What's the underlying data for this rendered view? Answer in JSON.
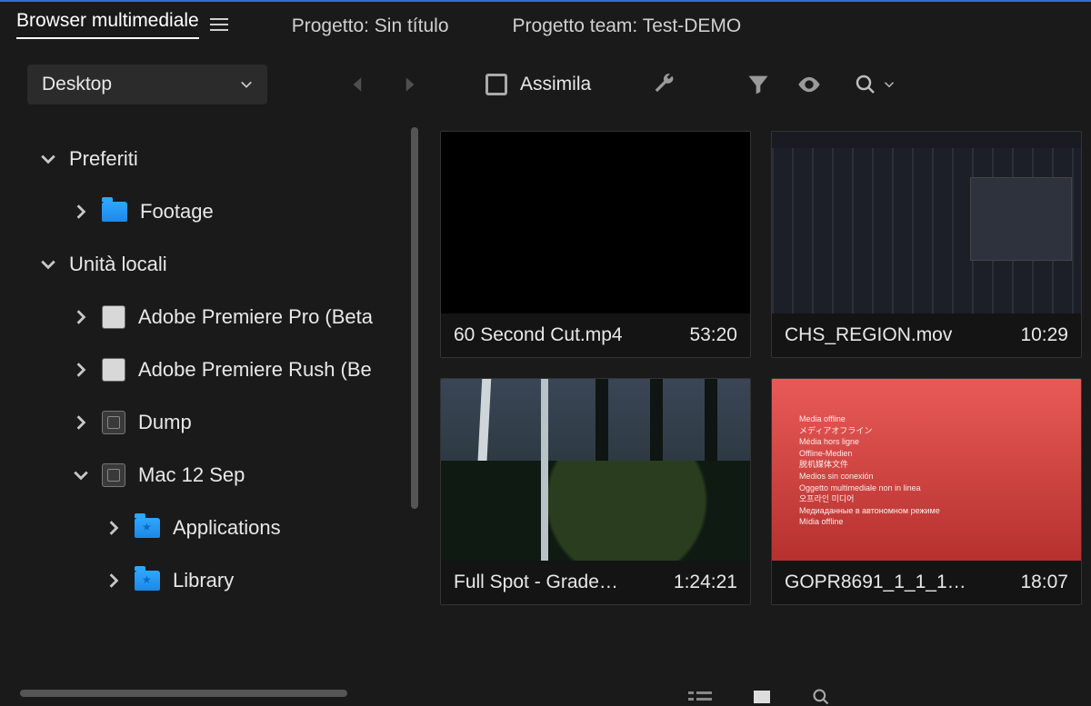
{
  "tabs": {
    "browser": "Browser multimediale",
    "project": "Progetto: Sin título",
    "team": "Progetto team: Test-DEMO"
  },
  "toolbar": {
    "location": "Desktop",
    "ingest_label": "Assimila"
  },
  "sidebar": {
    "favorites_label": "Preferiti",
    "local_label": "Unità locali",
    "items": {
      "footage": "Footage",
      "premiere": "Adobe Premiere Pro (Beta",
      "rush": "Adobe Premiere Rush (Be",
      "dump": "Dump",
      "mac12": "Mac 12 Sep",
      "apps": "Applications",
      "library": "Library"
    }
  },
  "clips": [
    {
      "name": "60 Second Cut.mp4",
      "duration": "53:20"
    },
    {
      "name": "CHS_REGION.mov",
      "duration": "10:29"
    },
    {
      "name": "Full Spot - Grade…",
      "duration": "1:24:21"
    },
    {
      "name": "GOPR8691_1_1_1…",
      "duration": "18:07"
    }
  ],
  "offline_text": "Media offline\nメディアオフライン\nMédia hors ligne\nOffline-Medien\n脱机媒体文件\nMedios sin conexión\nOggetto multimediale non in linea\n오프라인 미디어\nМедиаданные в автономном режиме\nMídia offline"
}
